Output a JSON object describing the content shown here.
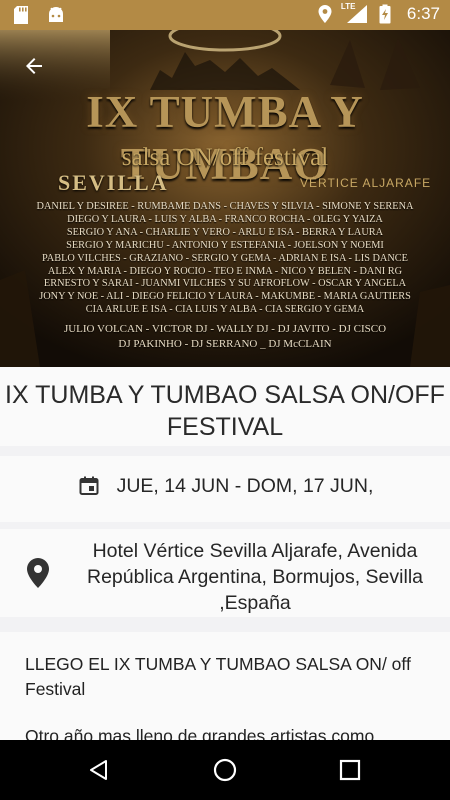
{
  "status_bar": {
    "time": "6:37",
    "network": "LTE",
    "icons": [
      "sd-card-icon",
      "android-icon",
      "location-icon",
      "signal-icon",
      "battery-charging-icon"
    ]
  },
  "banner": {
    "title": "IX TUMBA Y TUMBAO",
    "subtitle": "salsa ON/off festival",
    "city": "SEVILLA",
    "venue": "VÉRTICE ALJARAFE",
    "artist_lines": [
      "DANIEL Y DESIREE - RUMBAME DANS - CHAVES Y SILVIA - SIMONE Y SERENA",
      "DIEGO Y LAURA - LUIS Y ALBA - FRANCO ROCHA - OLEG Y YAIZA",
      "SERGIO Y ANA - CHARLIE Y VERO - ARLU E ISA - BERRA Y LAURA",
      "SERGIO Y MARICHU - ANTONIO Y ESTEFANIA - JOELSON Y NOEMI",
      "PABLO VILCHES - GRAZIANO - SERGIO Y GEMA - ADRIAN E ISA - LIS DANCE",
      "ALEX Y MARIA - DIEGO Y ROCIO - TEO E INMA - NICO Y BELEN - DANI RG",
      "ERNESTO Y SARAI - JUANMI VILCHES Y SU AFROFLOW - OSCAR Y ANGELA",
      "JONY Y NOE - ALI - DIEGO FELICIO Y LAURA - MAKUMBE - MARIA GAUTIERS",
      "CIA ARLUE E ISA - CIA LUIS Y ALBA - CIA SERGIO Y GEMA"
    ],
    "dj_lines": [
      "JULIO VOLCAN - VICTOR DJ - WALLY DJ - DJ JAVITO - DJ CISCO",
      "DJ PAKINHO - DJ SERRANO _ DJ McCLAIN"
    ]
  },
  "event": {
    "title": "IX TUMBA Y TUMBAO SALSA ON/OFF FESTIVAL",
    "date_icon": "calendar-icon",
    "date": "JUE, 14 JUN - DOM, 17 JUN,",
    "location_icon": "location-pin-icon",
    "location": "Hotel Vértice Sevilla Aljarafe, Avenida República Argentina, Bormujos, Sevilla ,España",
    "description_p1": "LLEGO EL IX TUMBA Y TUMBAO SALSA ON/ off Festival",
    "description_p2": "Otro año mas lleno de grandes artistas como"
  },
  "colors": {
    "status_bar": "#b38a45",
    "background": "#f2f2f4",
    "card": "#fafafa",
    "nav_bar": "#000000"
  },
  "nav_bar": {
    "icons": [
      "back-triangle-icon",
      "home-circle-icon",
      "recents-square-icon"
    ]
  }
}
